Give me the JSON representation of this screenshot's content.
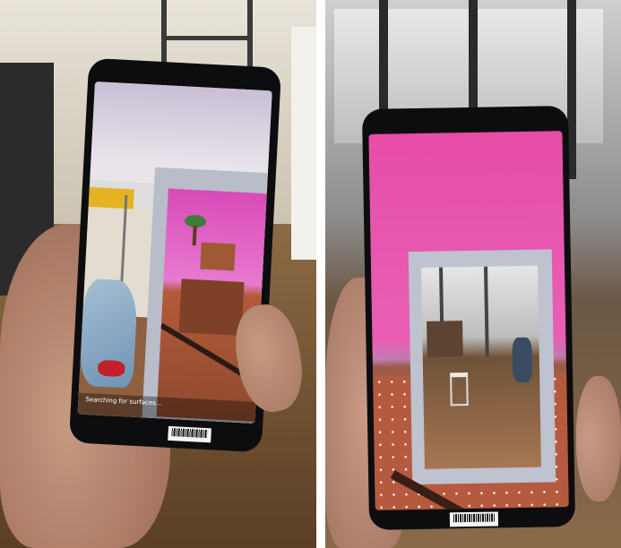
{
  "left_photo": {
    "status_text": "Searching for surfaces..."
  },
  "right_photo": {}
}
